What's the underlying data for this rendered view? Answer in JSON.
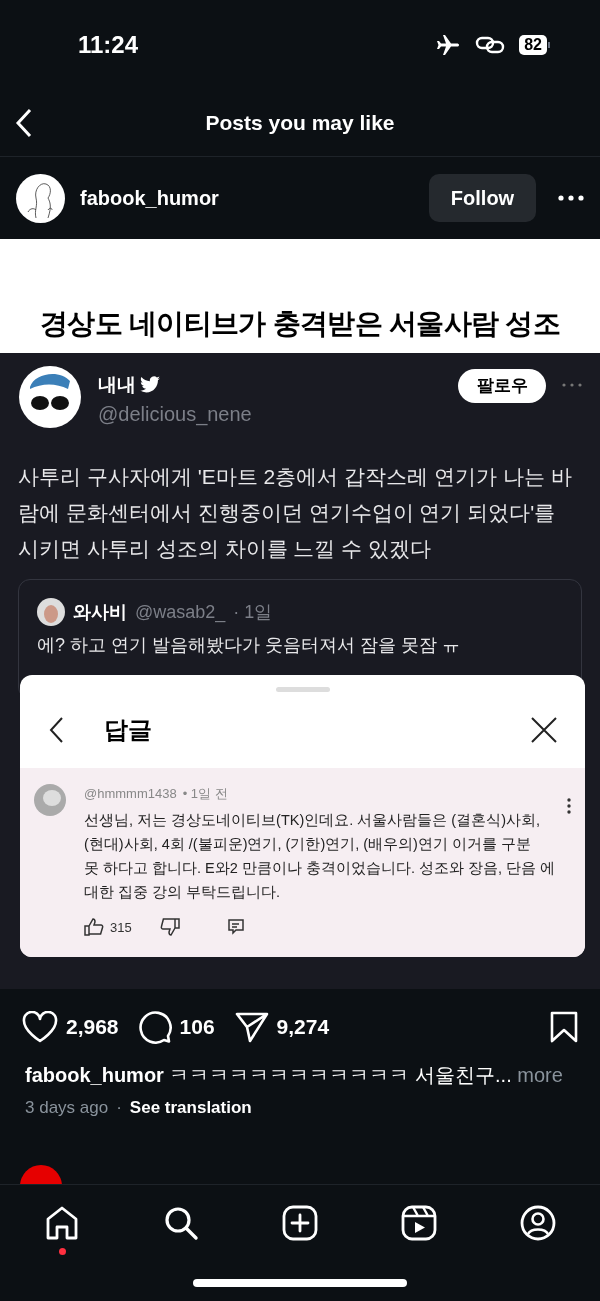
{
  "status_bar": {
    "time": "11:24",
    "battery": "82"
  },
  "header": {
    "title": "Posts you may like"
  },
  "post": {
    "username": "fabook_humor",
    "follow_button": "Follow"
  },
  "post_image": {
    "headline": "경상도 네이티브가 충격받은 서울사람 성조",
    "tweet": {
      "name": "내내",
      "handle": "@delicious_nene",
      "follow_button": "팔로우",
      "text": "사투리 구사자에게 'E마트 2층에서 갑작스레 연기가 나는 바\n람에 문화센터에서 진행중이던 연기수업이 연기 되었다'를\n시키면 사투리 성조의 차이를 느낄 수 있겠다",
      "quote": {
        "name": "와사비",
        "handle": "@wasab2_",
        "time": "· 1일",
        "text": "에? 하고 연기 발음해봤다가 웃음터져서 잠을 못잠 ㅠ"
      }
    },
    "reply_sheet": {
      "title": "답글",
      "comment": {
        "handle": "@hmmmm1438",
        "time": "• 1일 전",
        "text": "선생님, 저는 경상도네이티브(TK)인데요. 서울사람들은 (결혼식)사회,\n(현대)사회, 4회 /(불피운)연기, (기한)연기, (배우의)연기 이거를 구분\n못 하다고 합니다. E와2 만큼이나 충격이었습니다. 성조와 장음, 단음 에\n대한 집중 강의 부탁드립니다.",
        "likes": "315"
      }
    }
  },
  "actions": {
    "likes": "2,968",
    "comments": "106",
    "shares": "9,274"
  },
  "caption": {
    "username": "fabook_humor",
    "text": "ㅋㅋㅋㅋㅋㅋㅋㅋㅋㅋㅋㅋ 서울친구...",
    "more": "more"
  },
  "meta": {
    "time": "3 days ago",
    "separator": "·",
    "translation": "See translation"
  },
  "nav": [
    {
      "kind": "home",
      "notification": true
    },
    {
      "kind": "search",
      "notification": false
    },
    {
      "kind": "create",
      "notification": false
    },
    {
      "kind": "reels",
      "notification": false
    },
    {
      "kind": "profile",
      "notification": false
    }
  ]
}
